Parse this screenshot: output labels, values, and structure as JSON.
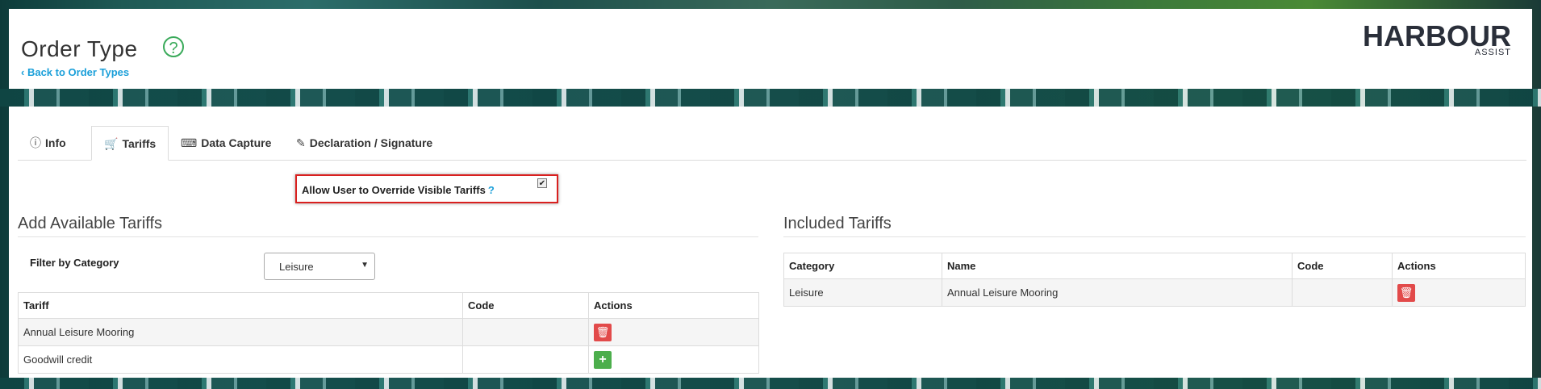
{
  "header": {
    "title": "Order Type",
    "help_icon": "?",
    "back_link": "Back to Order Types",
    "logo_main": "HARBOUR",
    "logo_sub": "ASSIST"
  },
  "tabs": [
    {
      "icon": "ⓘ",
      "label": "Info",
      "active": false
    },
    {
      "icon": "🛒",
      "label": "Tariffs",
      "active": true
    },
    {
      "icon": "⌨",
      "label": "Data Capture",
      "active": false
    },
    {
      "icon": "✎",
      "label": "Declaration / Signature",
      "active": false
    }
  ],
  "override": {
    "label": "Allow User to Override Visible Tariffs",
    "help": "?",
    "checked": true
  },
  "available": {
    "title": "Add Available Tariffs",
    "filter_label": "Filter by Category",
    "filter_value": "Leisure",
    "columns": [
      "Tariff",
      "Code",
      "Actions"
    ],
    "rows": [
      {
        "tariff": "Annual Leisure Mooring",
        "code": "",
        "action": "delete"
      },
      {
        "tariff": "Goodwill credit",
        "code": "",
        "action": "add"
      }
    ]
  },
  "included": {
    "title": "Included Tariffs",
    "columns": [
      "Category",
      "Name",
      "Code",
      "Actions"
    ],
    "rows": [
      {
        "category": "Leisure",
        "name": "Annual Leisure Mooring",
        "code": "",
        "action": "delete"
      }
    ]
  },
  "colors": {
    "accent": "#1a9fd9",
    "help_green": "#3aaa5a",
    "delete_red": "#e24a4a",
    "add_green": "#4cae4c",
    "highlight_border": "#d9201f"
  }
}
